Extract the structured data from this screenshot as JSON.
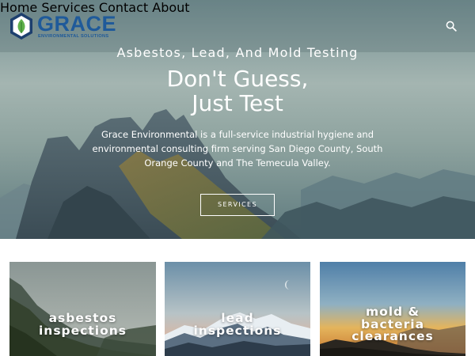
{
  "brand": {
    "name": "GRACE",
    "tagline": "ENVIRONMENTAL SOLUTIONS",
    "colors": {
      "blue": "#1f5a9a",
      "green": "#5fb04a",
      "navy": "#1d3f6e"
    }
  },
  "nav": {
    "items": [
      {
        "label": "Home",
        "active": true
      },
      {
        "label": "Services",
        "active": false
      },
      {
        "label": "Contact",
        "active": false
      },
      {
        "label": "About",
        "active": false
      }
    ],
    "search_icon": "search-icon"
  },
  "hero": {
    "kicker": "Asbestos, Lead, And Mold Testing",
    "headline_line1": "Don't Guess,",
    "headline_line2": "Just Test",
    "description": "Grace Environmental is a full-service industrial hygiene and environmental consulting firm serving San Diego County, South Orange County and The Temecula Valley.",
    "button_label": "SERVICES"
  },
  "cards": [
    {
      "lines": [
        "asbestos",
        "inspections"
      ]
    },
    {
      "lines": [
        "lead",
        "inspections"
      ]
    },
    {
      "lines": [
        "mold &",
        "bacteria",
        "clearances"
      ]
    }
  ]
}
